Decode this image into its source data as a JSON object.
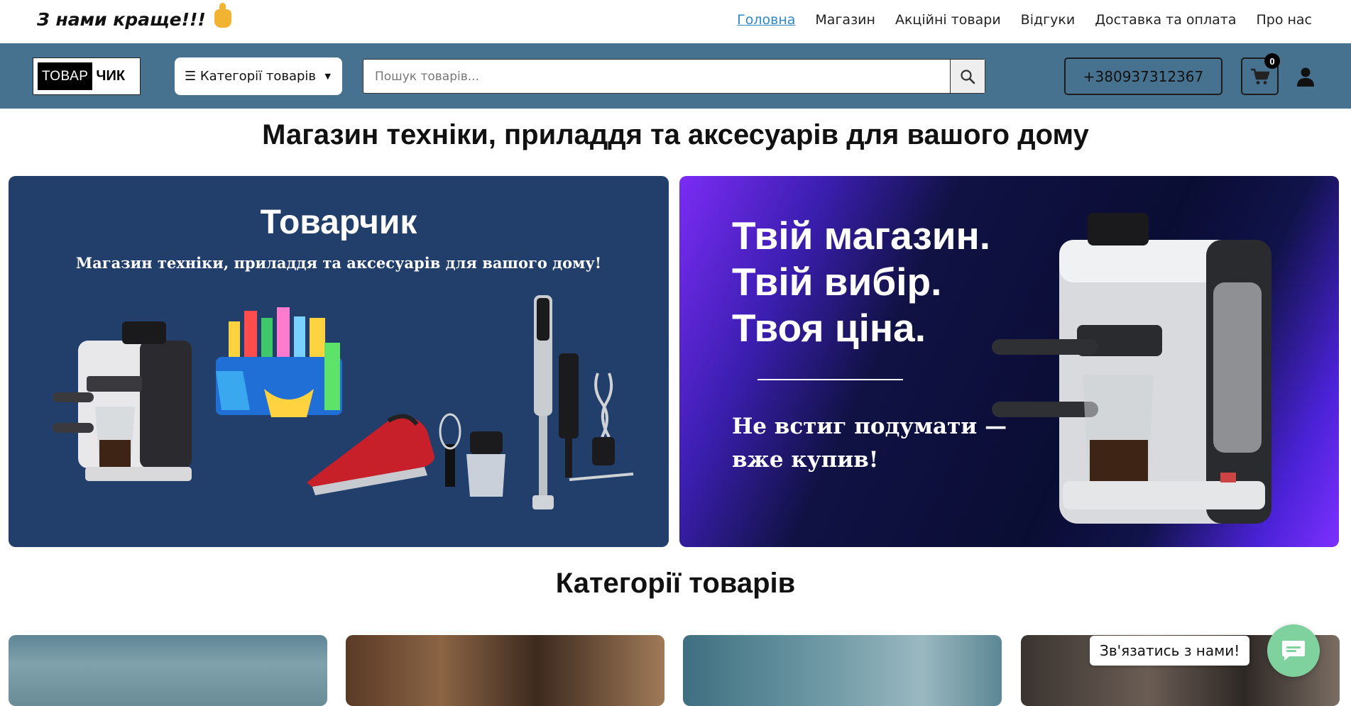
{
  "topbar": {
    "slogan": "З нами краще!!!",
    "nav": [
      "Головна",
      "Магазин",
      "Акційні товари",
      "Відгуки",
      "Доставка та оплата",
      "Про нас"
    ],
    "active_nav": "Головна"
  },
  "header": {
    "logo": {
      "part1": "ТОВАР",
      "part2": "ЧИК"
    },
    "categories_button": "☰ Категорії товарів",
    "search_placeholder": "Пошук товарів...",
    "phone": "+380937312367",
    "cart_count": "0"
  },
  "main": {
    "title": "Магазин техніки, приладдя та аксесуарів для вашого дому",
    "banner1": {
      "title": "Товарчик",
      "subtitle": "Магазин техніки, приладдя та аксесуарів для вашого дому!"
    },
    "banner2": {
      "lines": [
        "Твій магазин.",
        "Твій вибір.",
        "Твоя ціна."
      ],
      "tagline_1": "Не встиг подумати —",
      "tagline_2": "вже купив!"
    },
    "categories_title": "Категорії товарів"
  },
  "chat": {
    "label": "Зв'язатись з нами!"
  },
  "colors": {
    "header_bg": "#46728f",
    "nav_active": "#2f89c9",
    "banner1_bg": "#223e6a",
    "chat_button": "#7fd19d"
  }
}
